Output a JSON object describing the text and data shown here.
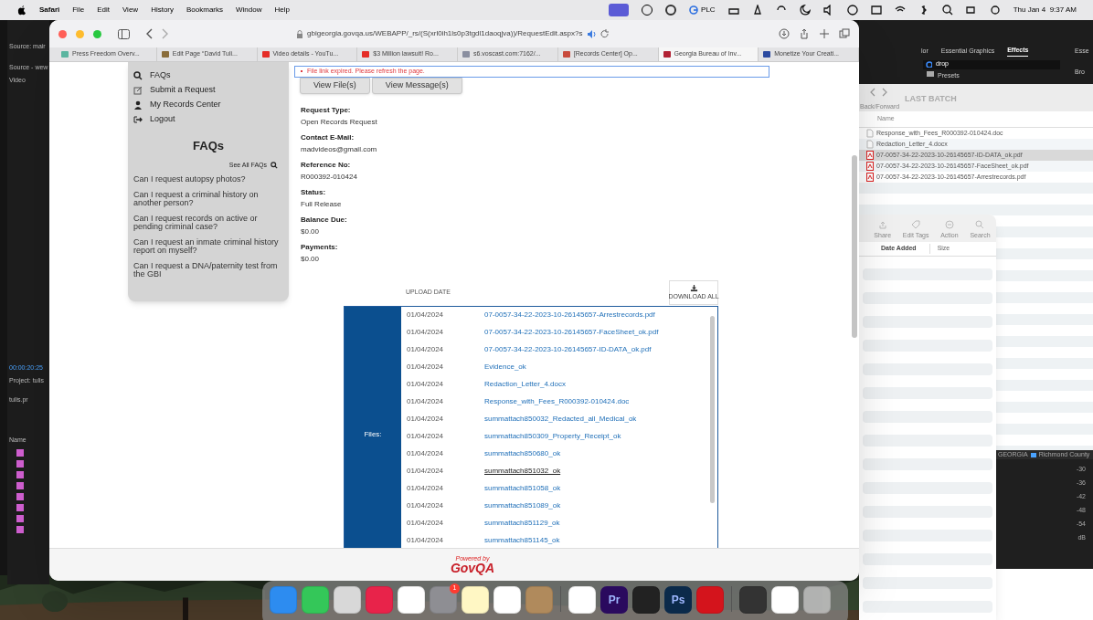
{
  "menu_bar": {
    "app": "Safari",
    "menus": [
      "File",
      "Edit",
      "View",
      "History",
      "Bookmarks",
      "Window",
      "Help"
    ],
    "status_text": "PLC",
    "clock": "Thu Jan 4  9:37 AM"
  },
  "editor_left": {
    "labels": [
      "Source: mair",
      "Source - wew",
      "Video",
      "00:00:20:25",
      "Project: tulis",
      "tulis.pr",
      "Name"
    ]
  },
  "editor_right": {
    "tabs": [
      {
        "label": "lor",
        "selected": false
      },
      {
        "label": "Essential Graphics",
        "selected": false
      },
      {
        "label": "Effects",
        "selected": true
      }
    ],
    "search": "drop",
    "folder": "Presets",
    "side_labels": [
      "Esse",
      "Bro"
    ],
    "breadcrumb": [
      "GEORGIA",
      "Richmond County"
    ],
    "meter_ticks": [
      "-30",
      "-36",
      "-42",
      "-48",
      "-54",
      "dB"
    ]
  },
  "finder": {
    "title": "LAST BATCH",
    "nav_label": "Back/Forward",
    "column": "Name",
    "files": [
      {
        "name": "Response_with_Fees_R000392-010424.doc",
        "kind": "doc",
        "selected": false
      },
      {
        "name": "Redaction_Letter_4.docx",
        "kind": "doc",
        "selected": false
      },
      {
        "name": "07-0057-34-22-2023-10-26145657-ID-DATA_ok.pdf",
        "kind": "pdf",
        "selected": true
      },
      {
        "name": "07-0057-34-22-2023-10-26145657-FaceSheet_ok.pdf",
        "kind": "pdf",
        "selected": false
      },
      {
        "name": "07-0057-34-22-2023-10-26145657-Arrestrecords.pdf",
        "kind": "pdf",
        "selected": false
      }
    ]
  },
  "finder_small": {
    "tools": [
      "Share",
      "Edit Tags",
      "Action",
      "Search"
    ],
    "columns": [
      "Date Added",
      "Size"
    ]
  },
  "safari": {
    "url": "gbigeorgia.govqa.us/WEBAPP/_rs/(S(xrl0ih1ls0p3tgdl1daoqjva))/RequestEdit.aspx?s",
    "tabs": [
      {
        "title": "Press Freedom Overv...",
        "selected": false
      },
      {
        "title": "Edit Page “David Tuli...",
        "selected": false
      },
      {
        "title": "Video details - YouTu...",
        "selected": false
      },
      {
        "title": "$3 Million lawsuit! Ro...",
        "selected": false
      },
      {
        "title": "s6.voscast.com:7162/...",
        "selected": false
      },
      {
        "title": "[Records Center] Op...",
        "selected": false
      },
      {
        "title": "Georgia Bureau of Inv...",
        "selected": true
      },
      {
        "title": "Monetize Your Creati...",
        "selected": false
      }
    ],
    "page": {
      "nav": [
        {
          "label": "FAQs",
          "kind": "search"
        },
        {
          "label": "Submit a Request",
          "kind": "edit"
        },
        {
          "label": "My Records Center",
          "kind": "person"
        },
        {
          "label": "Logout",
          "kind": "logout"
        }
      ],
      "faq_heading": "FAQs",
      "see_all": "See All FAQs",
      "faqs": [
        "Can I request autopsy photos?",
        "Can I request a criminal history on another person?",
        "Can I request records on active or pending criminal case?",
        "Can I request an inmate criminal history report on myself?",
        "Can I request a DNA/paternity test from the GBI"
      ],
      "error": "File link expired. Please refresh the page.",
      "buttons": [
        "View File(s)",
        "View Message(s)"
      ],
      "fields": [
        {
          "label": "Request Type:",
          "value": "Open Records Request"
        },
        {
          "label": "Contact E-Mail:",
          "value": "madvideos@gmail.com"
        },
        {
          "label": "Reference No:",
          "value": "R000392-010424"
        },
        {
          "label": "Status:",
          "value": "Full Release"
        },
        {
          "label": "Balance Due:",
          "value": "$0.00"
        },
        {
          "label": "Payments:",
          "value": "$0.00"
        }
      ],
      "files": {
        "column_header": "UPLOAD DATE",
        "download_all": "DOWNLOAD ALL",
        "side_label": "Files:",
        "rows": [
          {
            "date": "01/04/2024",
            "name": "07-0057-34-22-2023-10-26145657-Arrestrecords.pdf",
            "hovered": false
          },
          {
            "date": "01/04/2024",
            "name": "07-0057-34-22-2023-10-26145657-FaceSheet_ok.pdf",
            "hovered": false
          },
          {
            "date": "01/04/2024",
            "name": "07-0057-34-22-2023-10-26145657-ID-DATA_ok.pdf",
            "hovered": false
          },
          {
            "date": "01/04/2024",
            "name": "Evidence_ok",
            "hovered": false
          },
          {
            "date": "01/04/2024",
            "name": "Redaction_Letter_4.docx",
            "hovered": false
          },
          {
            "date": "01/04/2024",
            "name": "Response_with_Fees_R000392-010424.doc",
            "hovered": false
          },
          {
            "date": "01/04/2024",
            "name": "summattach850032_Redacted_all_Medical_ok",
            "hovered": false
          },
          {
            "date": "01/04/2024",
            "name": "summattach850309_Property_Receipt_ok",
            "hovered": false
          },
          {
            "date": "01/04/2024",
            "name": "summattach850680_ok",
            "hovered": false
          },
          {
            "date": "01/04/2024",
            "name": "summattach851032_ok",
            "hovered": true
          },
          {
            "date": "01/04/2024",
            "name": "summattach851058_ok",
            "hovered": false
          },
          {
            "date": "01/04/2024",
            "name": "summattach851089_ok",
            "hovered": false
          },
          {
            "date": "01/04/2024",
            "name": "summattach851129_ok",
            "hovered": false
          },
          {
            "date": "01/04/2024",
            "name": "summattach851145_ok",
            "hovered": false
          }
        ]
      },
      "footer": {
        "powered_by": "Powered by",
        "logo": "GovQA"
      }
    }
  },
  "dock": {
    "items": [
      {
        "kind": "finder"
      },
      {
        "kind": "messages"
      },
      {
        "kind": "launchpad"
      },
      {
        "kind": "creative"
      },
      {
        "kind": "photos"
      },
      {
        "kind": "settings",
        "badge": "1"
      },
      {
        "kind": "notes"
      },
      {
        "kind": "freeform"
      },
      {
        "kind": "contacts"
      },
      {
        "kind": "divider"
      },
      {
        "kind": "safari"
      },
      {
        "kind": "letter",
        "glyph": "Pr",
        "color": "#2a0a5e"
      },
      {
        "kind": "obs"
      },
      {
        "kind": "letter",
        "glyph": "Ps",
        "color": "#0b2a4a"
      },
      {
        "kind": "acrobat"
      },
      {
        "kind": "divider"
      },
      {
        "kind": "thumb"
      },
      {
        "kind": "thumb2"
      },
      {
        "kind": "trash"
      }
    ]
  }
}
